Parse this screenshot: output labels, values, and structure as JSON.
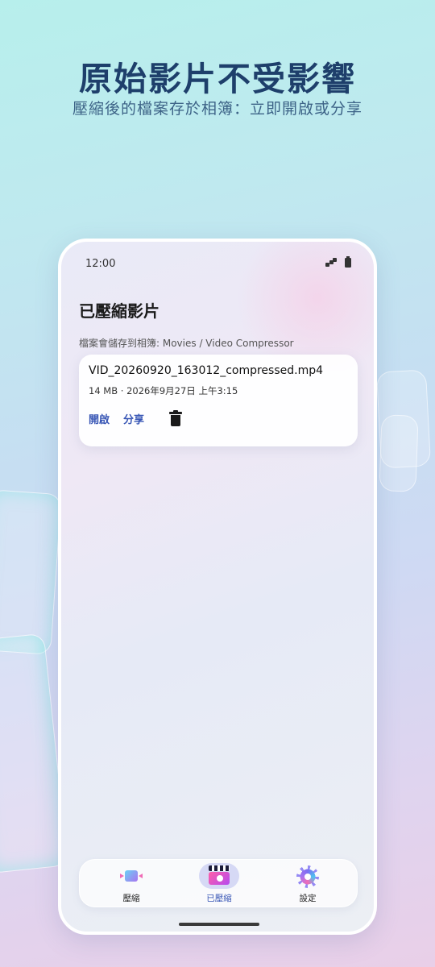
{
  "hero": {
    "title": "原始影片不受影響",
    "subtitle": "壓縮後的檔案存於相簿：立即開啟或分享"
  },
  "status_bar": {
    "time": "12:00",
    "icons": [
      "signal-icon",
      "battery-icon"
    ]
  },
  "screen": {
    "title": "已壓縮影片",
    "save_note": "檔案會儲存到相簿: Movies / Video Compressor"
  },
  "files": [
    {
      "name": "VID_20260920_163012_compressed.mp4",
      "meta": "14 MB · 2026年9月27日 上午3:15",
      "actions": {
        "open": "開啟",
        "share": "分享",
        "delete_icon": "trash-icon"
      }
    }
  ],
  "bottom_nav": {
    "items": [
      {
        "label": "壓縮",
        "icon": "compress-icon",
        "active": false
      },
      {
        "label": "已壓縮",
        "icon": "clapperboard-icon",
        "active": true
      },
      {
        "label": "設定",
        "icon": "gear-icon",
        "active": false
      }
    ]
  },
  "colors": {
    "accent": "#3856b5",
    "hero_title": "#1e3f6b"
  }
}
